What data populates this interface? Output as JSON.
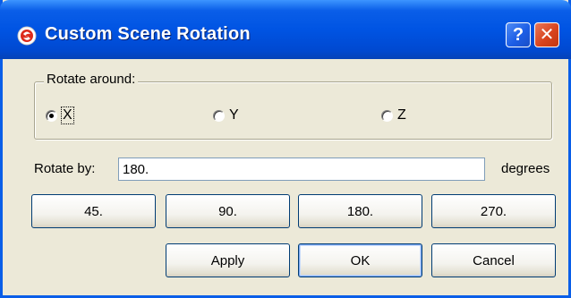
{
  "window": {
    "title": "Custom Scene Rotation",
    "help_label": "?",
    "close_label": "✕"
  },
  "rotate_around": {
    "label": "Rotate around:",
    "options": [
      {
        "label": "X",
        "selected": true
      },
      {
        "label": "Y",
        "selected": false
      },
      {
        "label": "Z",
        "selected": false
      }
    ]
  },
  "rotate_by": {
    "label": "Rotate by:",
    "value": "180.",
    "unit": "degrees"
  },
  "presets": [
    "45.",
    "90.",
    "180.",
    "270."
  ],
  "actions": {
    "apply": "Apply",
    "ok": "OK",
    "cancel": "Cancel"
  },
  "colors": {
    "titlebar": "#0054e3",
    "dialog_bg": "#ece9d8",
    "close_button": "#d9441e"
  }
}
